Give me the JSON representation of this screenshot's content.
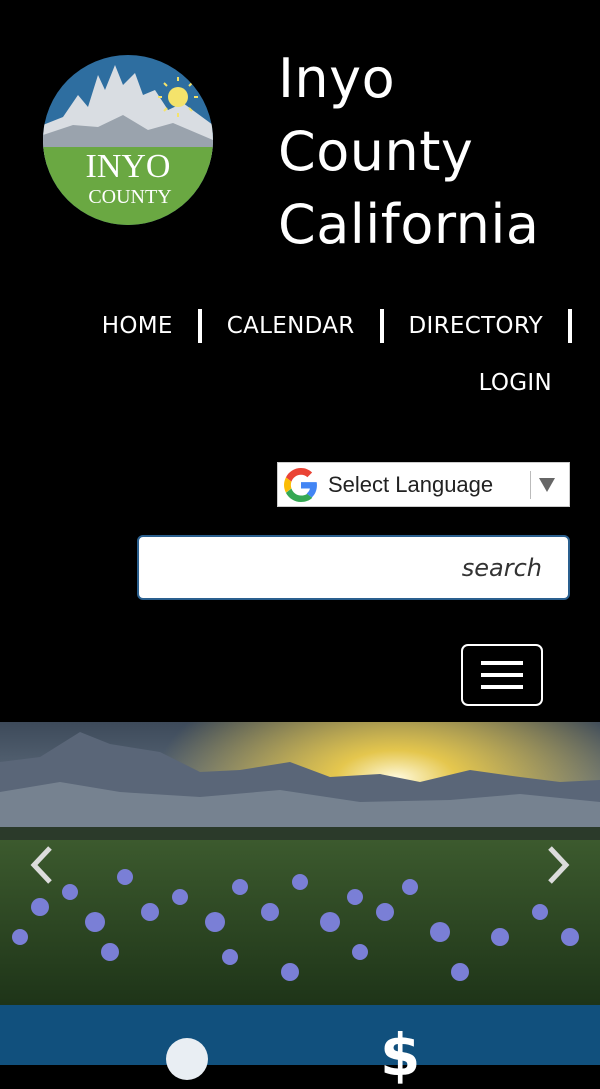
{
  "site": {
    "title_lines": [
      "Inyo",
      "County",
      "California"
    ],
    "logo_text_top": "INYO",
    "logo_text_bottom": "COUNTY"
  },
  "nav": {
    "items": [
      {
        "label": "HOME"
      },
      {
        "label": "CALENDAR"
      },
      {
        "label": "DIRECTORY"
      }
    ],
    "second_row": {
      "label": "LOGIN"
    }
  },
  "translate": {
    "label": "Select Language"
  },
  "search": {
    "placeholder": "search"
  },
  "colors": {
    "background": "#000000",
    "bottom_bar": "#11507d",
    "search_border": "#2a5f8e"
  },
  "icons": {
    "menu": "hamburger-menu-icon",
    "prev": "chevron-left-icon",
    "next": "chevron-right-icon",
    "google": "google-g-icon",
    "quick_link_1": "circle-icon",
    "quick_link_2": "dollar-icon"
  },
  "quick_links": {
    "dollar_symbol": "$"
  }
}
